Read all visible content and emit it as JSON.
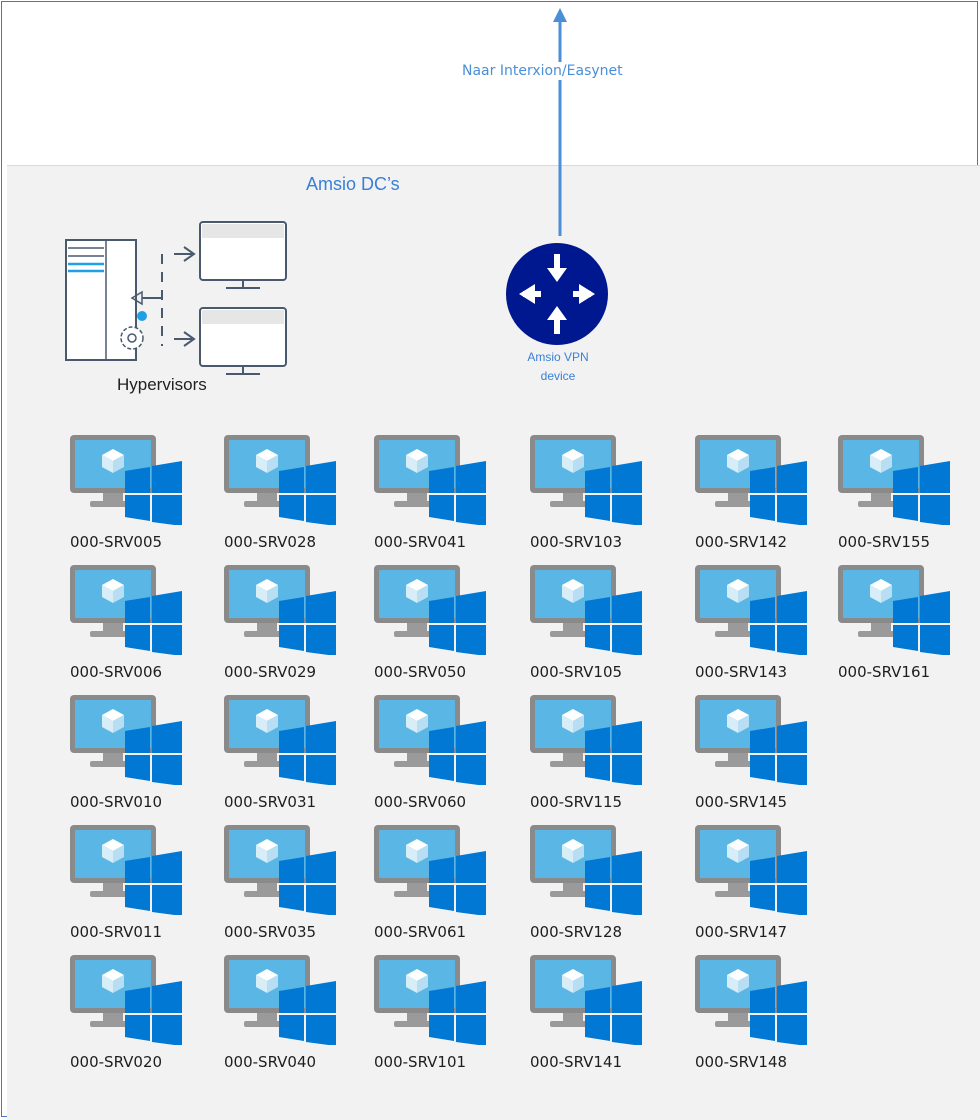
{
  "diagram": {
    "zone_title": "Amsio DC’s",
    "uplink_label": "Naar Interxion/Easynet",
    "router_label_line1": "Amsio VPN",
    "router_label_line2": "device",
    "hypervisors_label": "Hypervisors",
    "colors": {
      "frame": "#4a74c4",
      "zone": "#f2f2f2",
      "accent_text": "#3a7fd6",
      "router": "#00188f",
      "windows_blue": "#0078d4",
      "monitor_gray": "#7a7a7a",
      "screen_blue": "#5ab6e4"
    },
    "servers": [
      [
        "000-SRV005",
        "000-SRV006",
        "000-SRV010",
        "000-SRV011",
        "000-SRV020"
      ],
      [
        "000-SRV028",
        "000-SRV029",
        "000-SRV031",
        "000-SRV035",
        "000-SRV040"
      ],
      [
        "000-SRV041",
        "000-SRV050",
        "000-SRV060",
        "000-SRV061",
        "000-SRV101"
      ],
      [
        "000-SRV103",
        "000-SRV105",
        "000-SRV115",
        "000-SRV128",
        "000-SRV141"
      ],
      [
        "000-SRV142",
        "000-SRV143",
        "000-SRV145",
        "000-SRV147",
        "000-SRV148"
      ],
      [
        "000-SRV155",
        "000-SRV161"
      ]
    ]
  }
}
